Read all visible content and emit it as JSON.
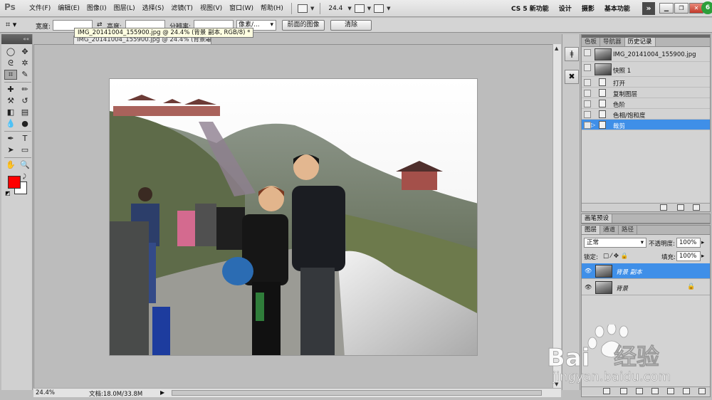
{
  "app": {
    "logo": "Ps"
  },
  "menu": [
    "文件(F)",
    "编辑(E)",
    "图像(I)",
    "图层(L)",
    "选择(S)",
    "滤镜(T)",
    "视图(V)",
    "窗口(W)",
    "帮助(H)"
  ],
  "menubar": {
    "zoom": "24.4",
    "workspaces": [
      "CS 5 新功能",
      "设计",
      "摄影",
      "基本功能"
    ],
    "expand": "»"
  },
  "options": {
    "width_label": "宽度:",
    "height_label": "高度:",
    "resolution_label": "分辨率:",
    "unit_select": "像素/...",
    "front_image_button": "前面的图像",
    "clear_button": "清除"
  },
  "tooltip": "IMG_20141004_155900.jpg @ 24.4% (背景 副本, RGB/8) *",
  "document": {
    "tab_title": "IMG_20141004_155900.jpg @ 24.4% (背景 副本, RGB/8) *",
    "status_zoom": "24.4%",
    "status_doc": "文档:18.0M/33.8M"
  },
  "history_panel": {
    "tabs": [
      "色板",
      "导航器",
      "历史记录"
    ],
    "snapshot_file": "IMG_20141004_155900.jpg",
    "snapshot_1": "快照 1",
    "steps": [
      "打开",
      "复制图层",
      "色阶",
      "色相/饱和度",
      "裁剪"
    ]
  },
  "brush_panel": {
    "tab": "画笔预设"
  },
  "layers_panel": {
    "tabs": [
      "图层",
      "通道",
      "路径"
    ],
    "blend_mode": "正常",
    "opacity_label": "不透明度:",
    "opacity": "100%",
    "lock_label": "锁定:",
    "fill_label": "填充:",
    "fill": "100%",
    "layers": [
      "背景 副本",
      "背景"
    ]
  },
  "watermark": {
    "brand": "Bai",
    "brand2": "经验",
    "url": "jingyan.baidu.com"
  }
}
